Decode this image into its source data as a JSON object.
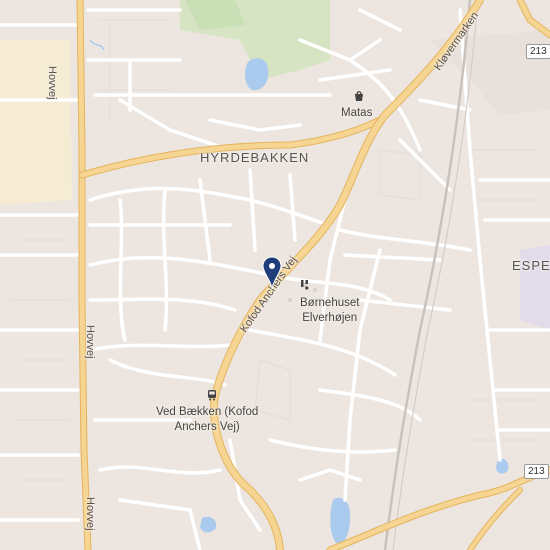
{
  "map": {
    "areas": [
      {
        "id": "hyrdebakken",
        "label": "HYRDEBAKKEN"
      },
      {
        "id": "espe",
        "label": "ESPE"
      }
    ],
    "roads": [
      {
        "id": "hovvej-top",
        "label": "Hovvej"
      },
      {
        "id": "hovvej-mid",
        "label": "Hovvej"
      },
      {
        "id": "hovvej-bottom",
        "label": "Hovvej"
      },
      {
        "id": "kofod",
        "label": "Kofod Anchers Vej"
      },
      {
        "id": "klovermarken",
        "label": "Kløvermarken"
      }
    ],
    "route_shields": [
      {
        "id": "route-top-right",
        "label": "213"
      },
      {
        "id": "route-right",
        "label": "213"
      }
    ],
    "pois": [
      {
        "id": "matas",
        "label": "Matas",
        "icon": "shopping-bag-icon"
      },
      {
        "id": "bornehuset",
        "label_line1": "Børnehuset",
        "label_line2": "Elverhøjen",
        "icon": "kindergarten-icon"
      },
      {
        "id": "bus-stop",
        "label_line1": "Ved Bækken (Kofod",
        "label_line2": "Anchers Vej)",
        "icon": "bus-stop-icon"
      }
    ],
    "pin": {
      "icon": "location-pin-icon"
    },
    "colors": {
      "background": "#ede6e0",
      "major_road": "#f2c97a",
      "minor_road": "#ffffff",
      "water": "#aacbee",
      "park": "#c9dfb5",
      "pin": "#1f3e7a"
    }
  }
}
